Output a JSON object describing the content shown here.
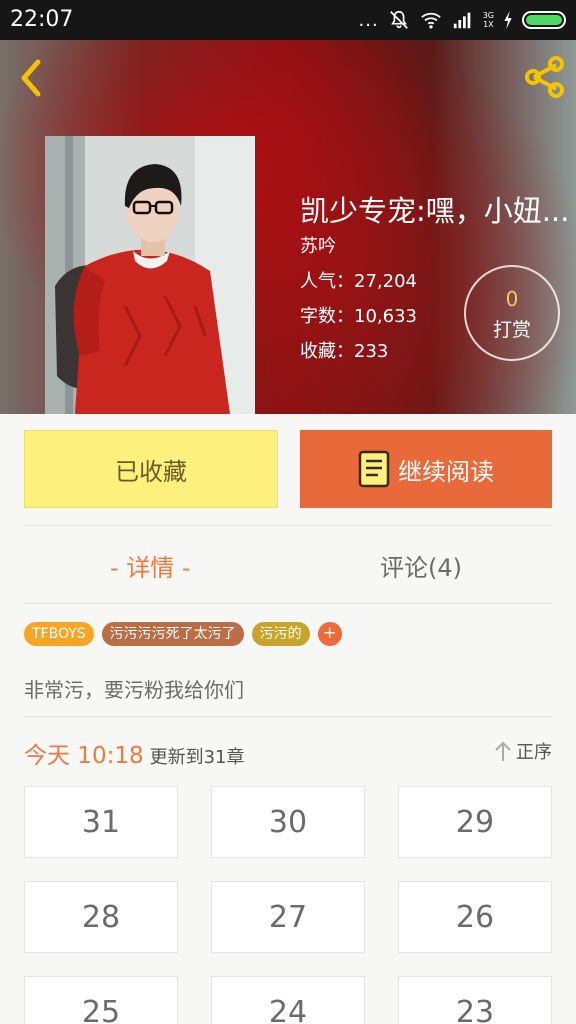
{
  "status_bar": {
    "time": "22:07",
    "dots": "...",
    "network_label": "3G",
    "network_sub": "1X"
  },
  "book": {
    "title": "凯少专宠:嘿，小妞...",
    "author": "苏吟",
    "popularity": "人气：27,204",
    "word_count": "字数：10,633",
    "favorites": "收藏：233",
    "tip_count": "0",
    "tip_label": "打赏"
  },
  "actions": {
    "collect_label": "已收藏",
    "read_label": "继续阅读"
  },
  "tabs": {
    "detail": "- 详情 -",
    "comments": "评论(4)"
  },
  "tags": [
    "TFBOYS",
    "污污污污死了太污了",
    "污污的"
  ],
  "tag_add": "+",
  "description": "非常污，要污粉我给你们",
  "update": {
    "time": "今天 10:18",
    "text": "更新到31章",
    "sort_label": "正序"
  },
  "chapters": [
    "31",
    "30",
    "29",
    "28",
    "27",
    "26",
    "25",
    "24",
    "23"
  ],
  "colors": {
    "accent": "#ee7a42",
    "read_button": "#e8693a",
    "collect_button": "#fdf07c",
    "back_icon": "#f5c400"
  }
}
